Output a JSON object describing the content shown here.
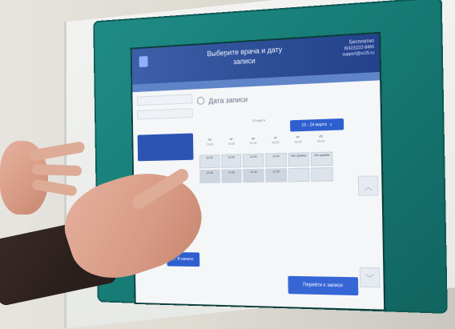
{
  "kiosk": {
    "header_title": "Выберите врача и дату записи",
    "brand_text": "",
    "hotline": {
      "label": "Бесплатно",
      "phone": "8(423)222-8466",
      "email": "support@vc25.ru"
    },
    "section_title": "Дата записи",
    "radio_label": "24 марта",
    "date_range": "19 - 24 марта",
    "days": [
      {
        "dow": "пн",
        "date": "19.03"
      },
      {
        "dow": "вт",
        "date": "20.03"
      },
      {
        "dow": "ср",
        "date": "21.03"
      },
      {
        "dow": "чт",
        "date": "22.03"
      },
      {
        "dow": "пт",
        "date": "23.03"
      },
      {
        "dow": "сб",
        "date": "24.03"
      }
    ],
    "slots": [
      [
        "12.00",
        "12.30"
      ],
      [
        "12.00",
        "12.30"
      ],
      [
        "12.00",
        "12.30"
      ],
      [
        "12.00",
        "12.30"
      ],
      [
        "Нет приёма",
        ""
      ],
      [
        "Нет приёма",
        ""
      ]
    ],
    "home_label": "В начало",
    "next_label": "Перейти к записи"
  },
  "colors": {
    "kiosk_teal": "#1b857f",
    "screen_header": "#2c4d96",
    "primary_button": "#2f5fcf"
  },
  "icons": {
    "home": "home-icon",
    "chevron_right": "chevron-right-icon",
    "arrow_up": "arrow-up-icon",
    "arrow_down": "arrow-down-icon",
    "calendar": "calendar-icon"
  }
}
